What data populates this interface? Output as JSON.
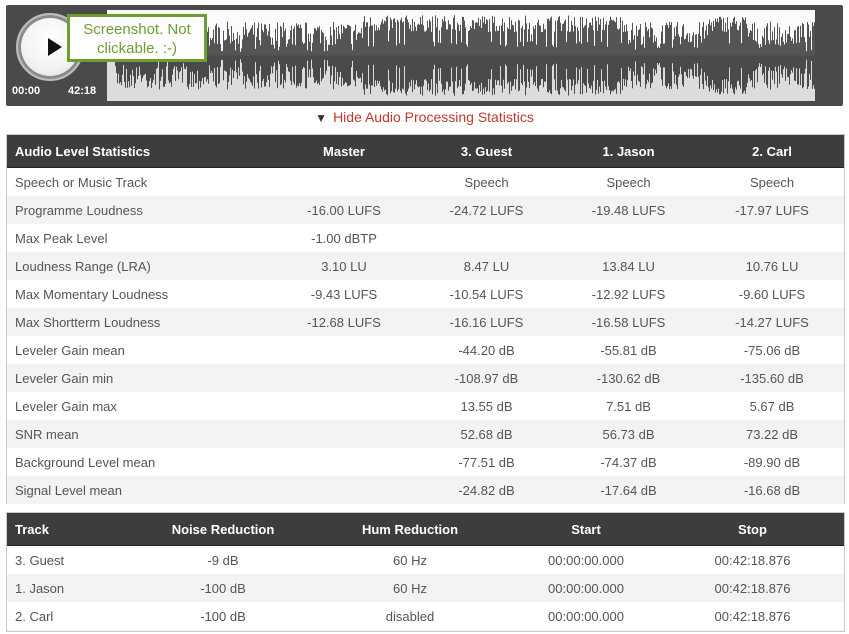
{
  "player": {
    "time_start": "00:00",
    "time_end": "42:18",
    "tooltip": "Screenshot. Not clickable. :-)"
  },
  "toggle_label": "Hide Audio Processing Statistics",
  "stats_table": {
    "headers": [
      "Audio Level Statistics",
      "Master",
      "3. Guest",
      "1. Jason",
      "2. Carl"
    ],
    "rows": [
      [
        "Speech or Music Track",
        "",
        "Speech",
        "Speech",
        "Speech"
      ],
      [
        "Programme Loudness",
        "-16.00 LUFS",
        "-24.72 LUFS",
        "-19.48 LUFS",
        "-17.97 LUFS"
      ],
      [
        "Max Peak Level",
        "-1.00 dBTP",
        "",
        "",
        ""
      ],
      [
        "Loudness Range (LRA)",
        "3.10 LU",
        "8.47 LU",
        "13.84 LU",
        "10.76 LU"
      ],
      [
        "Max Momentary Loudness",
        "-9.43 LUFS",
        "-10.54 LUFS",
        "-12.92 LUFS",
        "-9.60 LUFS"
      ],
      [
        "Max Shortterm Loudness",
        "-12.68 LUFS",
        "-16.16 LUFS",
        "-16.58 LUFS",
        "-14.27 LUFS"
      ],
      [
        "Leveler Gain mean",
        "",
        "-44.20 dB",
        "-55.81 dB",
        "-75.06 dB"
      ],
      [
        "Leveler Gain min",
        "",
        "-108.97 dB",
        "-130.62 dB",
        "-135.60 dB"
      ],
      [
        "Leveler Gain max",
        "",
        "13.55 dB",
        "7.51 dB",
        "5.67 dB"
      ],
      [
        "SNR mean",
        "",
        "52.68 dB",
        "56.73 dB",
        "73.22 dB"
      ],
      [
        "Background Level mean",
        "",
        "-77.51 dB",
        "-74.37 dB",
        "-89.90 dB"
      ],
      [
        "Signal Level mean",
        "",
        "-24.82 dB",
        "-17.64 dB",
        "-16.68 dB"
      ]
    ]
  },
  "tracks_table": {
    "headers": [
      "Track",
      "Noise Reduction",
      "Hum Reduction",
      "Start",
      "Stop"
    ],
    "rows": [
      [
        "3. Guest",
        "-9 dB",
        "60 Hz",
        "00:00:00.000",
        "00:42:18.876"
      ],
      [
        "1. Jason",
        "-100 dB",
        "60 Hz",
        "00:00:00.000",
        "00:42:18.876"
      ],
      [
        "2. Carl",
        "-100 dB",
        "disabled",
        "00:00:00.000",
        "00:42:18.876"
      ]
    ]
  },
  "colors": {
    "accent_link": "#c0392b",
    "tooltip_green": "#6b9f32",
    "header_bg": "#3d3d3d"
  },
  "icons": [
    "play-icon",
    "triangle-down-icon"
  ]
}
